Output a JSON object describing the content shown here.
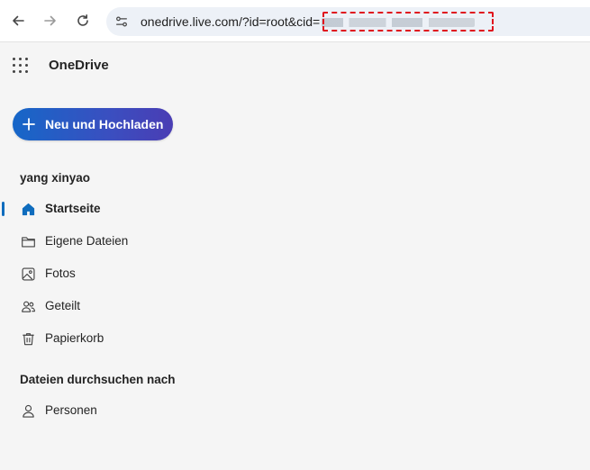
{
  "browser": {
    "url_visible": "onedrive.live.com/?id=root&cid="
  },
  "app": {
    "title": "OneDrive"
  },
  "new_button": {
    "label": "Neu und Hochladen"
  },
  "account": {
    "name": "yang xinyao"
  },
  "nav": {
    "items": [
      {
        "label": "Startseite",
        "icon": "home-icon",
        "active": true
      },
      {
        "label": "Eigene Dateien",
        "icon": "folder-icon"
      },
      {
        "label": "Fotos",
        "icon": "image-icon"
      },
      {
        "label": "Geteilt",
        "icon": "people-icon"
      },
      {
        "label": "Papierkorb",
        "icon": "trash-icon"
      }
    ]
  },
  "browse_by": {
    "heading": "Dateien durchsuchen nach",
    "items": [
      {
        "label": "Personen",
        "icon": "person-icon"
      }
    ]
  },
  "colors": {
    "accent": "#0f6cbd",
    "button_gradient_start": "#1667c8",
    "button_gradient_end": "#4a3db4",
    "redaction": "#e0141e"
  }
}
